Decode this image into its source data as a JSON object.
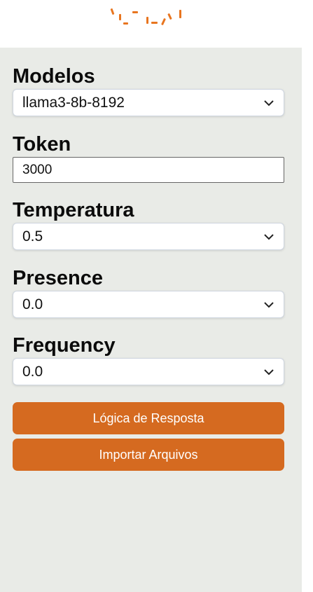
{
  "colors": {
    "accent": "#d56a20",
    "panel_bg": "#e9ebe7",
    "logo": "#e8751f"
  },
  "logo": {
    "icon": "brand-logo"
  },
  "fields": {
    "modelos": {
      "label": "Modelos",
      "value": "llama3-8b-8192",
      "icon": "chevron-down-icon"
    },
    "token": {
      "label": "Token",
      "value": "3000"
    },
    "temperatura": {
      "label": "Temperatura",
      "value": "0.5",
      "icon": "chevron-down-icon"
    },
    "presence": {
      "label": "Presence",
      "value": "0.0",
      "icon": "chevron-down-icon"
    },
    "frequency": {
      "label": "Frequency",
      "value": "0.0",
      "icon": "chevron-down-icon"
    }
  },
  "buttons": {
    "logica": "Lógica de Resposta",
    "importar": "Importar Arquivos"
  }
}
